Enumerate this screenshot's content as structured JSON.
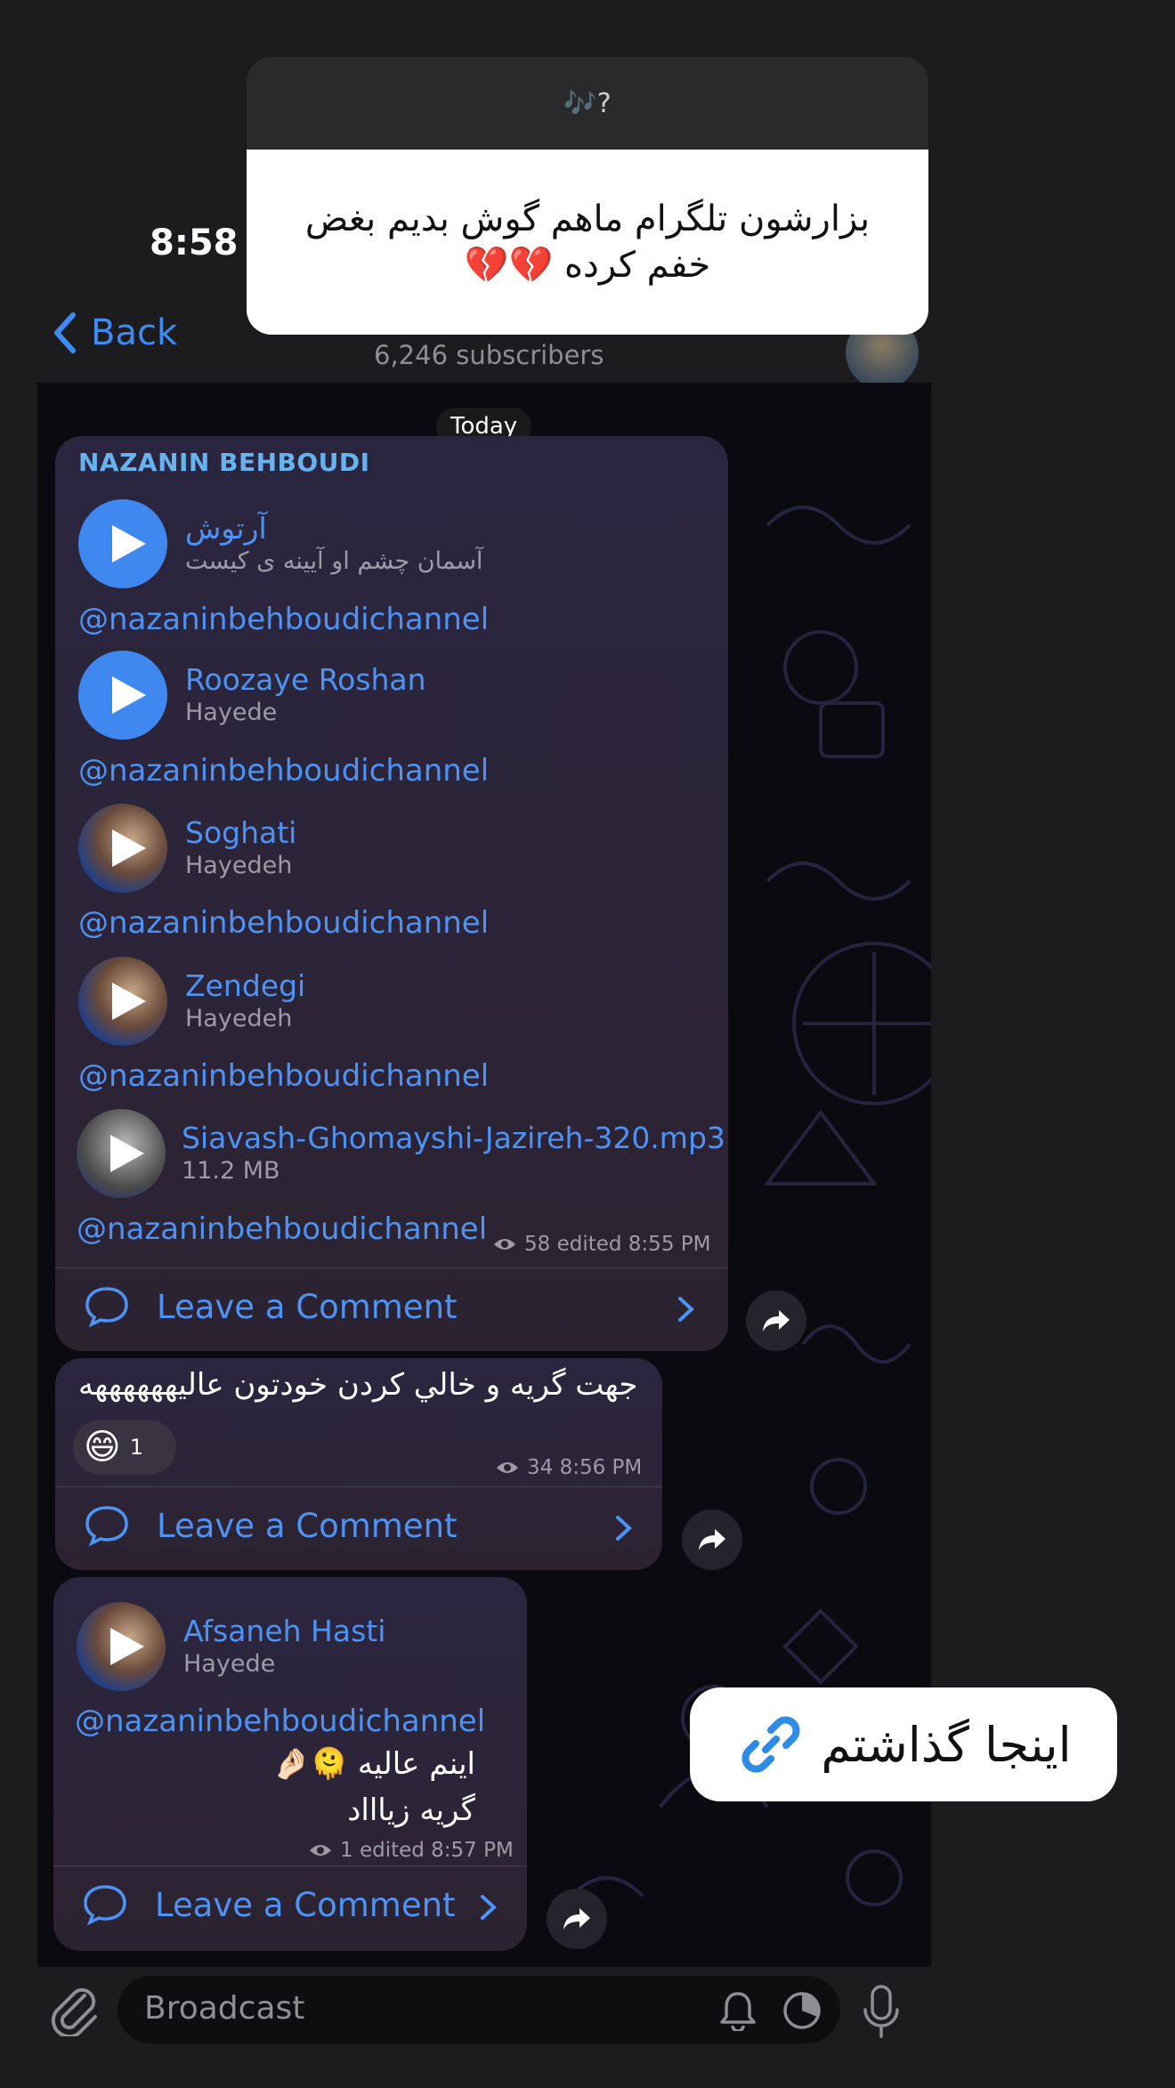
{
  "question_card": {
    "header": "🎶?",
    "text": "بزارشون تلگرام ماهم گوش بدیم بغض خفم کرده 💔💔"
  },
  "status_bar": {
    "time": "8:58"
  },
  "nav": {
    "back_label": "Back",
    "subscribers": "6,246 subscribers"
  },
  "chat": {
    "date_label": "Today",
    "post1": {
      "sender": "NAZANIN BEHBOUDI",
      "tracks": [
        {
          "title": "آرتوش",
          "subtitle": "آسمان چشم او آیینه ی کیست",
          "handle": "@nazaninbehboudichannel"
        },
        {
          "title": "Roozaye Roshan",
          "subtitle": "Hayede",
          "handle": "@nazaninbehboudichannel"
        },
        {
          "title": "Soghati",
          "subtitle": "Hayedeh",
          "handle": "@nazaninbehboudichannel"
        },
        {
          "title": "Zendegi",
          "subtitle": "Hayedeh",
          "handle": "@nazaninbehboudichannel"
        },
        {
          "title": "Siavash-Ghomayshi-Jazireh-320.mp3",
          "subtitle": "11.2 MB",
          "handle": "@nazaninbehboudichannel"
        }
      ],
      "meta": "58 edited 8:55 PM",
      "comment_label": "Leave a Comment"
    },
    "post2": {
      "text": "جهت گریه و خالي كردن خودتون عاليههههههه",
      "reaction_emoji": "😄",
      "reaction_count": "1",
      "meta": "34 8:56 PM",
      "comment_label": "Leave a Comment"
    },
    "post3": {
      "track": {
        "title": "Afsaneh Hasti",
        "subtitle": "Hayede"
      },
      "handle": "@nazaninbehboudichannel",
      "line1": "اینم عالیه 🫠🤌🏻",
      "line2": "گریه زیاااد",
      "meta": "1 edited 8:57 PM",
      "comment_label": "Leave a Comment"
    }
  },
  "sticker": {
    "text": "اینجا گذاشتم"
  },
  "composer": {
    "placeholder": "Broadcast"
  },
  "colors": {
    "accent": "#4e93f4",
    "bubble": "#2b2640",
    "background": "#0b0a10"
  }
}
